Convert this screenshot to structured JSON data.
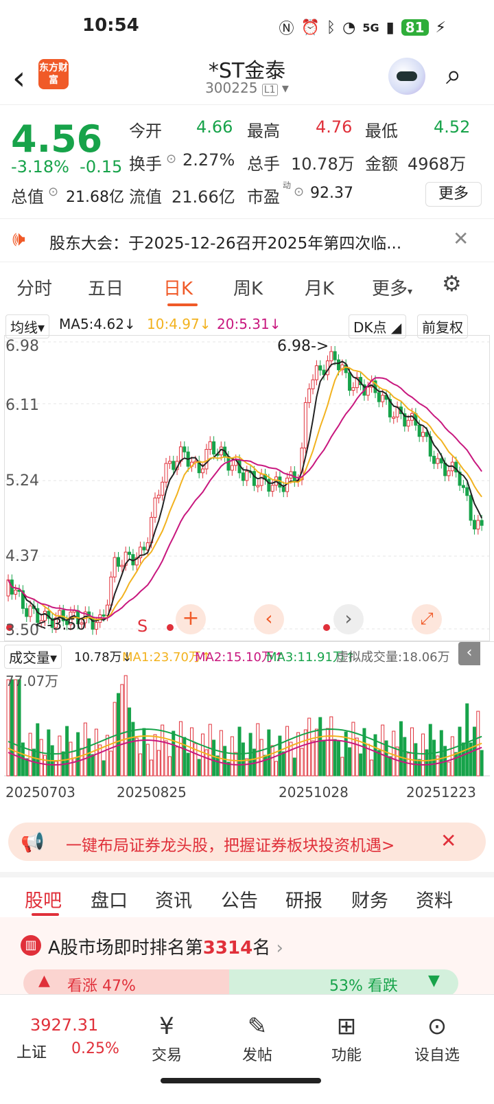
{
  "status_bar": {
    "time": "10:54",
    "network": "5G",
    "battery": "81"
  },
  "header": {
    "title": "*ST金泰",
    "code": "300225",
    "level": "L1",
    "brand_logo": "东方财富"
  },
  "quote": {
    "price": "4.56",
    "change_pct": "-3.18%",
    "change": "-0.15",
    "open_label": "今开",
    "open": "4.66",
    "high_label": "最高",
    "high": "4.76",
    "low_label": "最低",
    "low": "4.52",
    "turnover_label": "换手",
    "turnover": "2.27%",
    "volume_label": "总手",
    "volume": "10.78万",
    "amount_label": "金额",
    "amount": "4968万",
    "mktcap_label": "总值",
    "mktcap": "21.68亿",
    "float_label": "流值",
    "float": "21.66亿",
    "pe_label": "市盈",
    "pe_sup": "动",
    "pe": "92.37",
    "more": "更多"
  },
  "notice": {
    "text": "股东大会：于2025-12-26召开2025年第四次临..."
  },
  "period_tabs": [
    "分时",
    "五日",
    "日K",
    "周K",
    "月K",
    "更多"
  ],
  "ma_legend": {
    "toggle": "均线",
    "ma5": "MA5:4.62↓",
    "ma10": "10:4.97↓",
    "ma20": "20:5.31↓",
    "dk": "DK点",
    "adjust": "前复权"
  },
  "kchart": {
    "y_ticks": [
      "6.98",
      "6.11",
      "5.24",
      "4.37",
      "3.50"
    ],
    "high_marker": "6.98->",
    "low_marker": "<-3.50",
    "signal": "S",
    "colors": {
      "up": "#e0303a",
      "down": "#17a34a",
      "ma5": "#222222",
      "ma10": "#f2b21f",
      "ma20": "#c8177e"
    }
  },
  "vol_legend": {
    "toggle": "成交量",
    "vol": "10.78万↓",
    "ma1": "MA1:23.70万↑",
    "ma2": "MA2:15.10万↑",
    "ma3": "MA3:11.91万↑",
    "virtual": "虚拟成交量:18.06万",
    "max": "77.07万"
  },
  "dates": [
    "20250703",
    "20250825",
    "20251028",
    "20251223"
  ],
  "ad": {
    "text": "一键布局证券龙头股，把握证券板块投资机遇>"
  },
  "sub_tabs": [
    "股吧",
    "盘口",
    "资讯",
    "公告",
    "研报",
    "财务",
    "资料"
  ],
  "rank": {
    "prefix": "A股市场即时排名第",
    "number": "3314",
    "suffix": "名",
    "up_label": "看涨 47%",
    "down_label": "53% 看跌"
  },
  "bottom_nav": {
    "index_value": "3927.31",
    "index_name": "上证",
    "index_pct": "0.25%",
    "items": [
      "交易",
      "发帖",
      "功能",
      "设自选"
    ]
  }
}
